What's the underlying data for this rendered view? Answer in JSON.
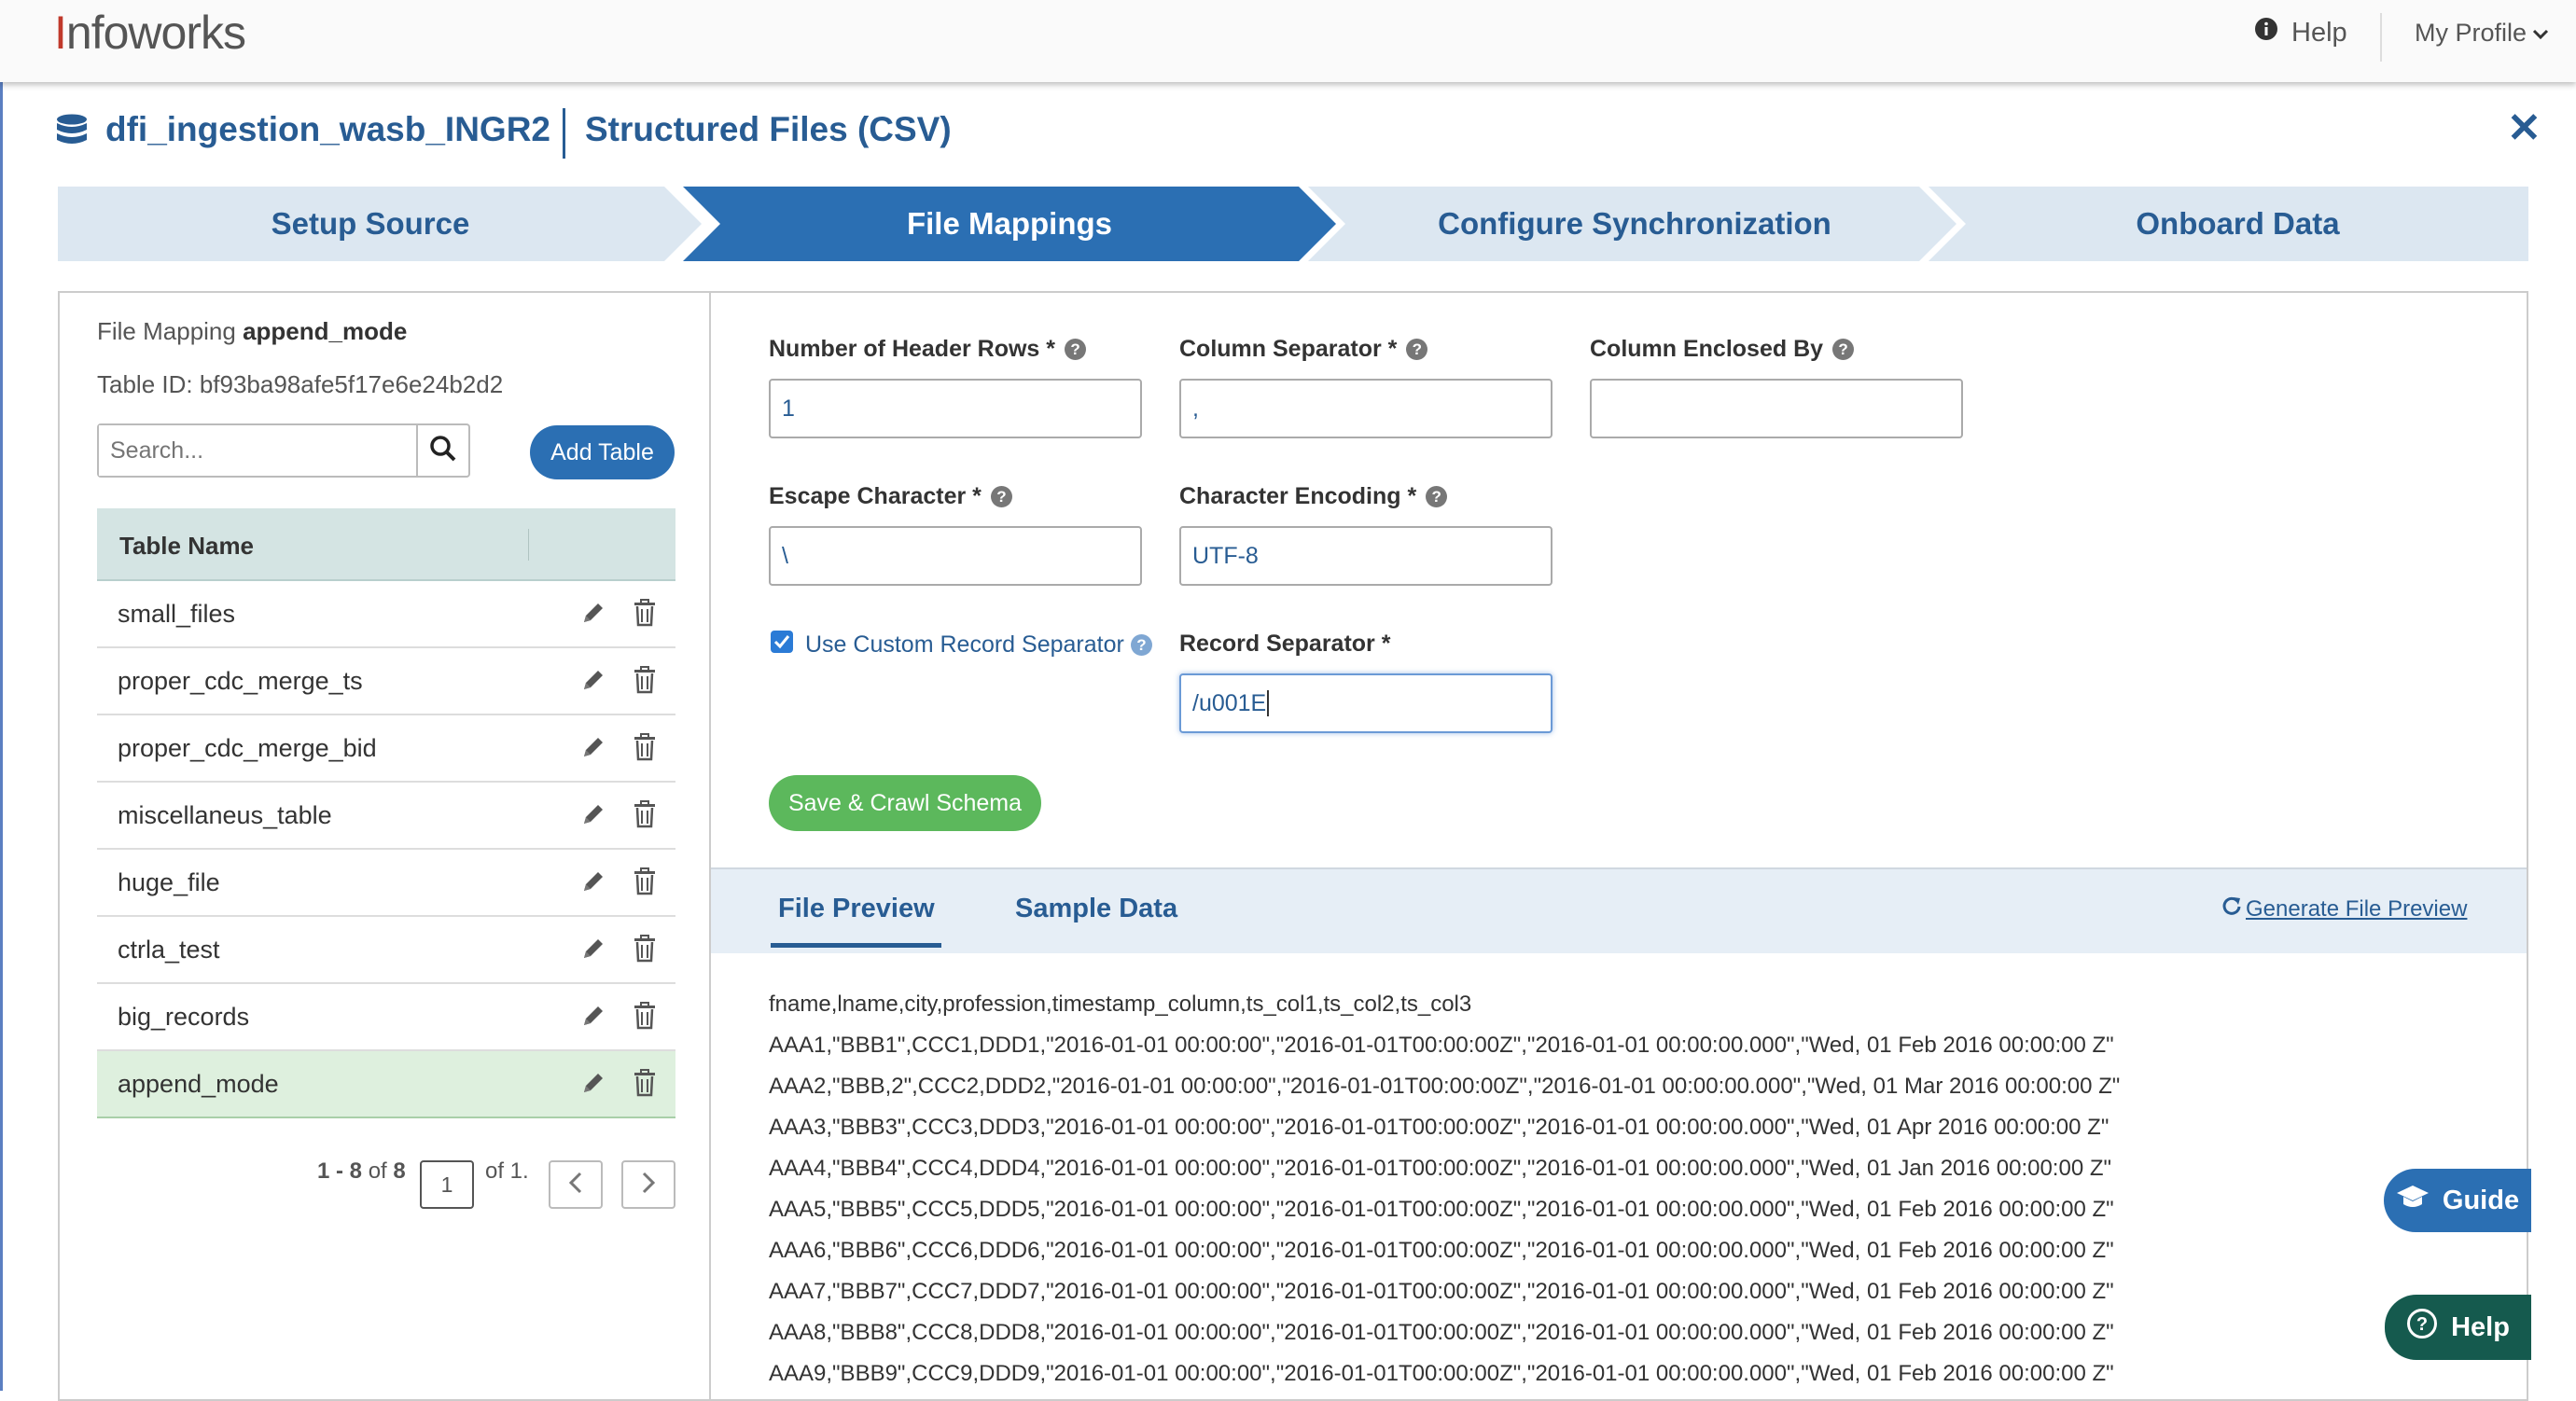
{
  "app": {
    "logo_prefix": "I",
    "logo_rest": "nfoworks",
    "help": "Help",
    "profile": "My Profile"
  },
  "header": {
    "connection_name": "dfi_ingestion_wasb_INGR2",
    "source_type": "Structured Files (CSV)"
  },
  "steps": [
    {
      "label": "Setup Source",
      "active": false
    },
    {
      "label": "File Mappings",
      "active": true
    },
    {
      "label": "Configure Synchronization",
      "active": false
    },
    {
      "label": "Onboard Data",
      "active": false
    }
  ],
  "left": {
    "mapping_prefix": "File Mapping ",
    "mapping_name": "append_mode",
    "table_id": "Table ID: bf93ba98afe5f17e6e24b2d2",
    "search_placeholder": "Search...",
    "add_table": "Add Table",
    "column_header": "Table Name",
    "tables": [
      "small_files",
      "proper_cdc_merge_ts",
      "proper_cdc_merge_bid",
      "miscellaneus_table",
      "huge_file",
      "ctrla_test",
      "big_records",
      "append_mode"
    ],
    "selected_table": "append_mode",
    "pager_range": "1 - 8",
    "pager_of": "of",
    "pager_total": "8",
    "pager_page": "1",
    "pager_pages": "of 1."
  },
  "form": {
    "header_rows_label": "Number of Header Rows *",
    "header_rows_value": "1",
    "column_separator_label": "Column Separator *",
    "column_separator_value": ",",
    "column_enclosed_label": "Column Enclosed By",
    "column_enclosed_value": "",
    "escape_char_label": "Escape Character *",
    "escape_char_value": "\\",
    "encoding_label": "Character Encoding *",
    "encoding_value": "UTF-8",
    "custom_record_sep_label": "Use Custom Record Separator",
    "custom_record_sep_checked": true,
    "record_sep_label": "Record Separator *",
    "record_sep_value": "/u001E",
    "save_button": "Save & Crawl Schema"
  },
  "preview": {
    "tab_file_preview": "File Preview",
    "tab_sample_data": "Sample Data",
    "generate": "Generate File Preview",
    "lines": [
      "fname,lname,city,profession,timestamp_column,ts_col1,ts_col2,ts_col3",
      "AAA1,\"BBB1\",CCC1,DDD1,\"2016-01-01 00:00:00\",\"2016-01-01T00:00:00Z\",\"2016-01-01 00:00:00.000\",\"Wed, 01 Feb 2016 00:00:00 Z\"",
      "AAA2,\"BBB,2\",CCC2,DDD2,\"2016-01-01 00:00:00\",\"2016-01-01T00:00:00Z\",\"2016-01-01 00:00:00.000\",\"Wed, 01 Mar 2016 00:00:00 Z\"",
      "AAA3,\"BBB3\",CCC3,DDD3,\"2016-01-01 00:00:00\",\"2016-01-01T00:00:00Z\",\"2016-01-01 00:00:00.000\",\"Wed, 01 Apr 2016 00:00:00 Z\"",
      "AAA4,\"BBB4\",CCC4,DDD4,\"2016-01-01 00:00:00\",\"2016-01-01T00:00:00Z\",\"2016-01-01 00:00:00.000\",\"Wed, 01 Jan 2016 00:00:00 Z\"",
      "AAA5,\"BBB5\",CCC5,DDD5,\"2016-01-01 00:00:00\",\"2016-01-01T00:00:00Z\",\"2016-01-01 00:00:00.000\",\"Wed, 01 Feb 2016 00:00:00 Z\"",
      "AAA6,\"BBB6\",CCC6,DDD6,\"2016-01-01 00:00:00\",\"2016-01-01T00:00:00Z\",\"2016-01-01 00:00:00.000\",\"Wed, 01 Feb 2016 00:00:00 Z\"",
      "AAA7,\"BBB7\",CCC7,DDD7,\"2016-01-01 00:00:00\",\"2016-01-01T00:00:00Z\",\"2016-01-01 00:00:00.000\",\"Wed, 01 Feb 2016 00:00:00 Z\"",
      "AAA8,\"BBB8\",CCC8,DDD8,\"2016-01-01 00:00:00\",\"2016-01-01T00:00:00Z\",\"2016-01-01 00:00:00.000\",\"Wed, 01 Feb 2016 00:00:00 Z\"",
      "AAA9,\"BBB9\",CCC9,DDD9,\"2016-01-01 00:00:00\",\"2016-01-01T00:00:00Z\",\"2016-01-01 00:00:00.000\",\"Wed, 01 Feb 2016 00:00:00 Z\""
    ]
  },
  "floating": {
    "guide": "Guide",
    "help": "Help"
  },
  "colors": {
    "brand_blue": "#285c93",
    "active_step": "#2b6fb3",
    "inactive_step": "#dce7f1",
    "save_green": "#5cb85c",
    "selected_row": "#def0de",
    "help_float": "#155a4e"
  }
}
